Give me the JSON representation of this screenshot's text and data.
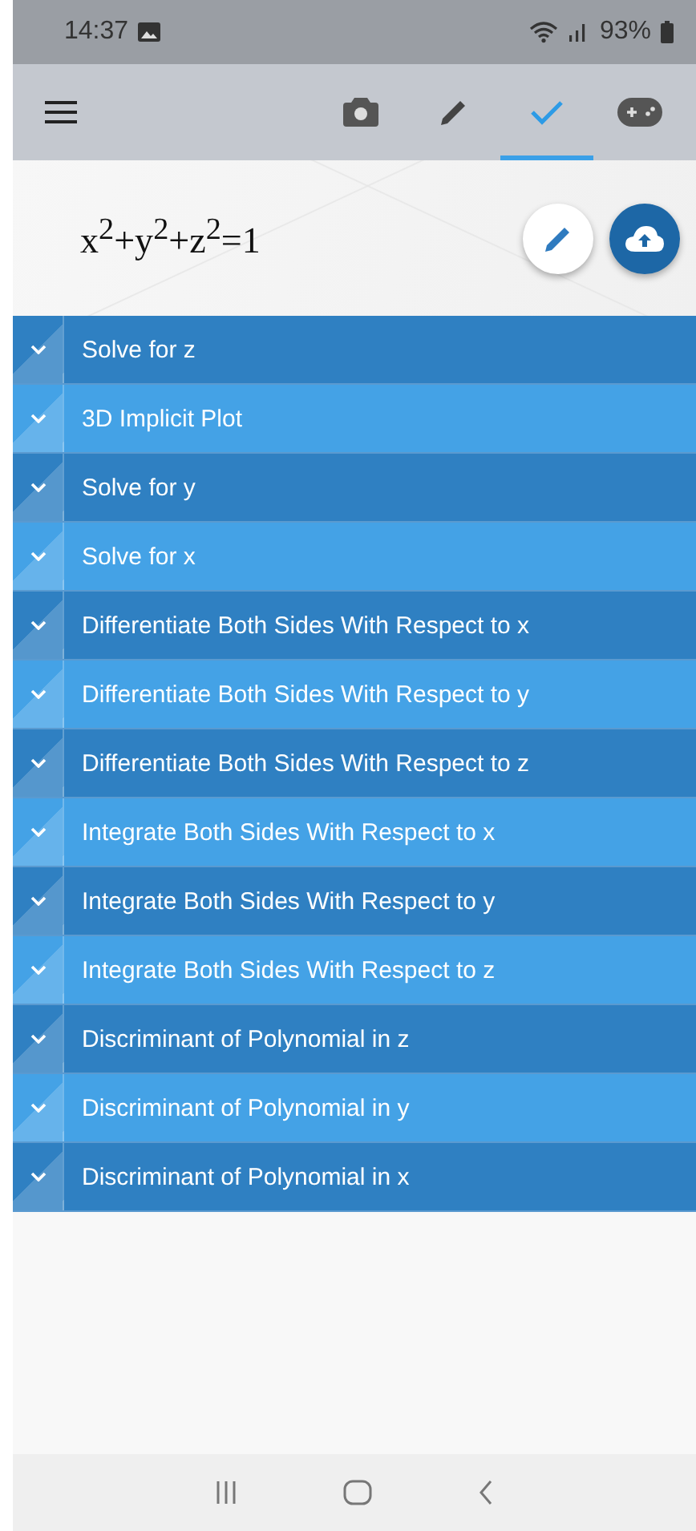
{
  "status_bar": {
    "time": "14:37",
    "battery": "93%"
  },
  "tabs": [
    {
      "kind": "camera",
      "selected": false
    },
    {
      "kind": "pencil",
      "selected": false
    },
    {
      "kind": "check",
      "selected": true
    },
    {
      "kind": "gamepad",
      "selected": false
    }
  ],
  "equation": "x$^{2}$+y$^{2}$+z$^{2}$=1",
  "results": [
    {
      "label": "Solve for z",
      "expanded": false
    },
    {
      "label": "3D Implicit Plot",
      "expanded": false
    },
    {
      "label": "Solve for y",
      "expanded": false
    },
    {
      "label": "Solve for x",
      "expanded": false
    },
    {
      "label": "Differentiate Both Sides With Respect to x",
      "expanded": false
    },
    {
      "label": "Differentiate Both Sides With Respect to y",
      "expanded": false
    },
    {
      "label": "Differentiate Both Sides With Respect to z",
      "expanded": false
    },
    {
      "label": "Integrate Both Sides With Respect to x",
      "expanded": false
    },
    {
      "label": "Integrate Both Sides With Respect to y",
      "expanded": false
    },
    {
      "label": "Integrate Both Sides With Respect to z",
      "expanded": false
    },
    {
      "label": "Discriminant of Polynomial in z",
      "expanded": false
    },
    {
      "label": "Discriminant of Polynomial in y",
      "expanded": false
    },
    {
      "label": "Discriminant of Polynomial in x",
      "expanded": false
    }
  ]
}
